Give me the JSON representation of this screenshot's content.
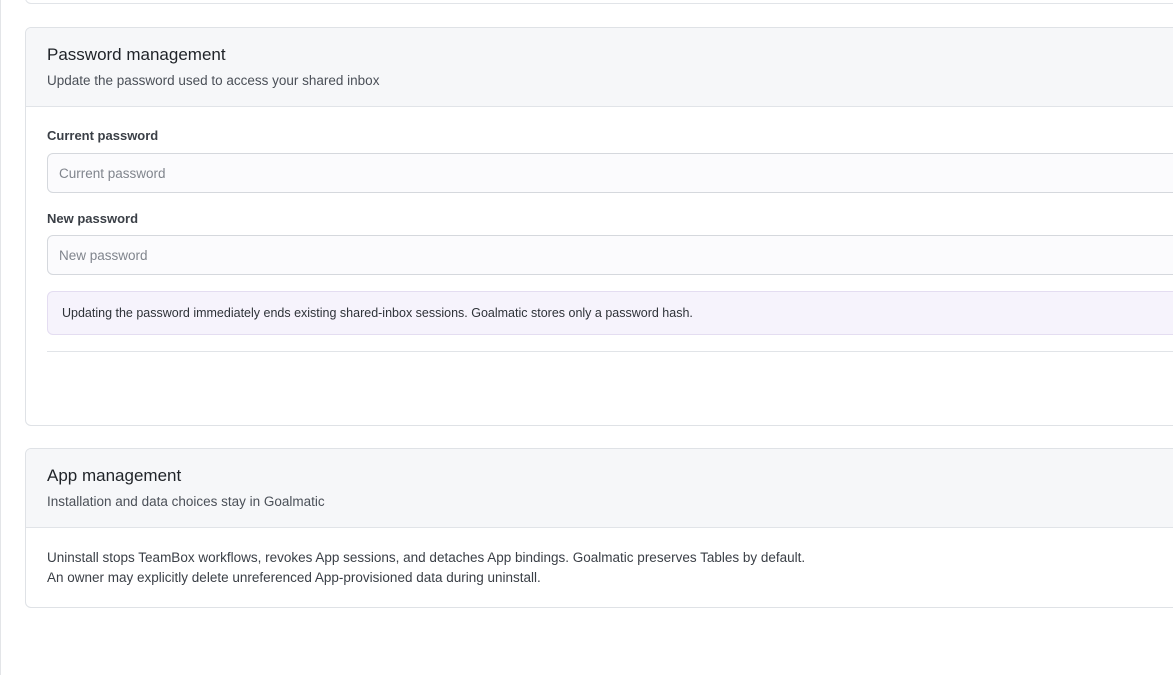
{
  "password_section": {
    "title": "Password management",
    "subtitle": "Update the password used to access your shared inbox",
    "current_password": {
      "label": "Current password",
      "placeholder": "Current password",
      "value": ""
    },
    "new_password": {
      "label": "New password",
      "placeholder": "New password",
      "value": ""
    },
    "notice": "Updating the password immediately ends existing shared-inbox sessions. Goalmatic stores only a password hash."
  },
  "app_section": {
    "title": "App management",
    "subtitle": "Installation and data choices stay in Goalmatic",
    "body": "Uninstall stops TeamBox workflows, revokes App sessions, and detaches App bindings. Goalmatic preserves Tables by default. An owner may explicitly delete unreferenced App-provisioned data during uninstall."
  },
  "colors": {
    "header_bg": "#f6f7f9",
    "notice_bg": "#f6f3fc",
    "border": "#dfe2e6"
  }
}
